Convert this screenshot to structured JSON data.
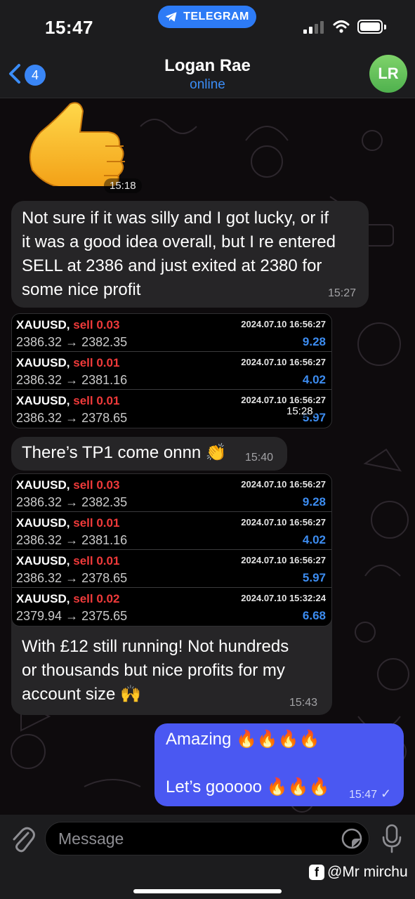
{
  "status_bar": {
    "time": "15:47",
    "app_pill": "TELEGRAM",
    "icons": [
      "telegram-plane-icon",
      "cellular-signal-icon",
      "wifi-icon",
      "battery-icon"
    ]
  },
  "header": {
    "back_badge": "4",
    "name": "Logan Rae",
    "status": "online",
    "avatar_initials": "LR"
  },
  "messages": {
    "sticker": {
      "emoji": "thumbs-up",
      "time": "15:18"
    },
    "msg1": {
      "text": "Not sure if it was silly and I got lucky, or if\nit was a good idea overall, but I re entered\nSELL at 2386 and just exited at 2380 for\nsome nice profit",
      "time": "15:27"
    },
    "table1": {
      "time": "15:28",
      "rows": [
        {
          "symbol": "XAUUSD,",
          "side": "sell 0.03",
          "date": "2024.07.10 16:56:27",
          "price": "2386.32 → 2382.35",
          "profit": "9.28"
        },
        {
          "symbol": "XAUUSD,",
          "side": "sell 0.01",
          "date": "2024.07.10 16:56:27",
          "price": "2386.32 → 2381.16",
          "profit": "4.02"
        },
        {
          "symbol": "XAUUSD,",
          "side": "sell 0.01",
          "date": "2024.07.10 16:56:27",
          "price": "2386.32 → 2378.65",
          "profit": "5.97"
        }
      ]
    },
    "msg2": {
      "text": "There’s TP1 come onnn 👏",
      "time": "15:40"
    },
    "table2": {
      "rows": [
        {
          "symbol": "XAUUSD,",
          "side": "sell 0.03",
          "date": "2024.07.10 16:56:27",
          "price": "2386.32 → 2382.35",
          "profit": "9.28"
        },
        {
          "symbol": "XAUUSD,",
          "side": "sell 0.01",
          "date": "2024.07.10 16:56:27",
          "price": "2386.32 → 2381.16",
          "profit": "4.02"
        },
        {
          "symbol": "XAUUSD,",
          "side": "sell 0.01",
          "date": "2024.07.10 16:56:27",
          "price": "2386.32 → 2378.65",
          "profit": "5.97"
        },
        {
          "symbol": "XAUUSD,",
          "side": "sell 0.02",
          "date": "2024.07.10 15:32:24",
          "price": "2379.94 → 2375.65",
          "profit": "6.68"
        }
      ]
    },
    "msg3": {
      "text": "With £12 still running! Not hundreds\nor thousands but nice profits for my\naccount size 🙌",
      "time": "15:43"
    },
    "msg4": {
      "text": "Amazing 🔥🔥🔥🔥\n\nLet’s gooooo 🔥🔥🔥",
      "time": "15:47",
      "read_mark": "✓"
    }
  },
  "input_bar": {
    "placeholder": "Message",
    "watermark": "@Mr mirchu"
  },
  "colors": {
    "accent": "#3b8df7",
    "outgoing_bubble": "#4a58f2",
    "incoming_bubble": "#262527",
    "sell": "#f03a3a",
    "profit": "#3c8cf0"
  }
}
